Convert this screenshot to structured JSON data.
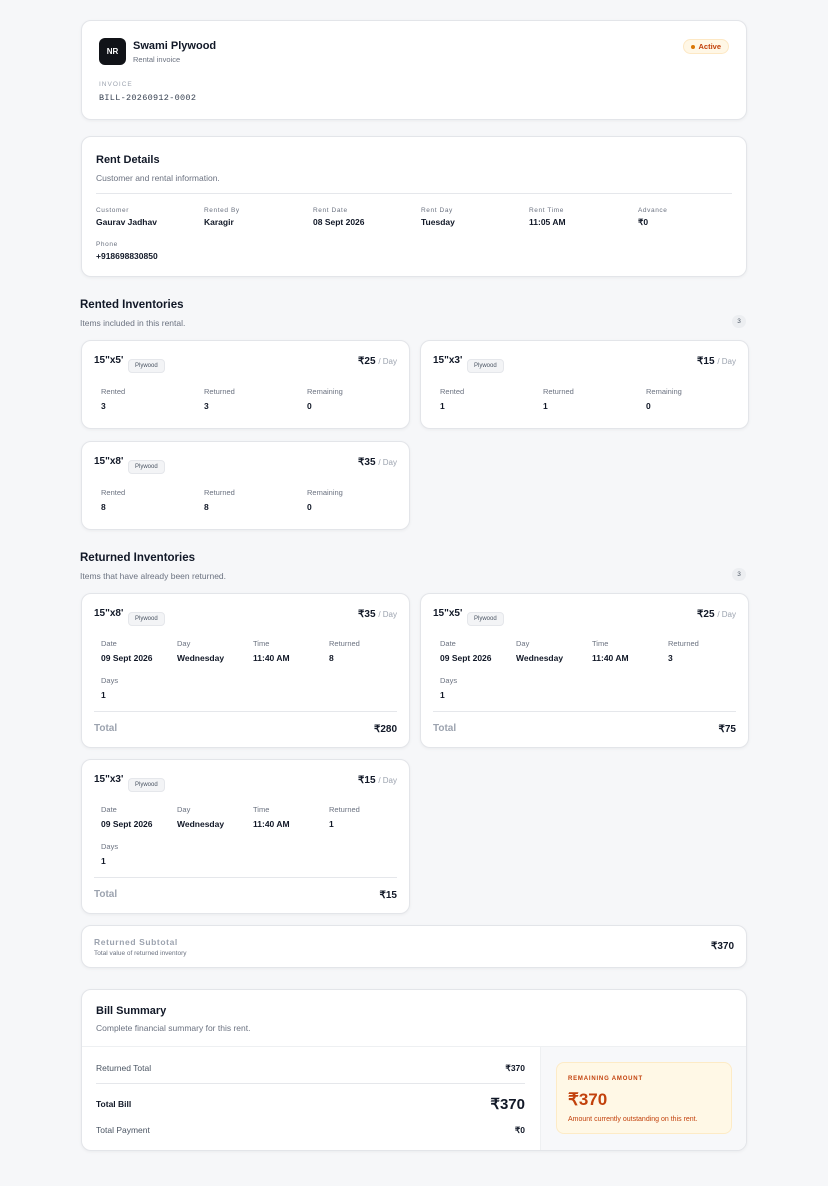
{
  "header": {
    "logo_initials": "NR",
    "business_name": "Swami Plywood",
    "subtitle": "Rental invoice",
    "status": "Active",
    "invoice_label": "INVOICE",
    "invoice_number": "BILL-20260912-0002"
  },
  "rent_details": {
    "title": "Rent Details",
    "subtitle": "Customer and rental information.",
    "fields": [
      {
        "label": "Customer",
        "value": "Gaurav Jadhav"
      },
      {
        "label": "Rented By",
        "value": "Karagir"
      },
      {
        "label": "Rent Date",
        "value": "08 Sept 2026"
      },
      {
        "label": "Rent Day",
        "value": "Tuesday"
      },
      {
        "label": "Rent Time",
        "value": "11:05 AM"
      },
      {
        "label": "Advance",
        "value": "₹0"
      },
      {
        "label": "Phone",
        "value": "+918698830850"
      }
    ]
  },
  "rented": {
    "title": "Rented Inventories",
    "subtitle": "Items included in this rental.",
    "count": "3",
    "col_labels": [
      "Rented",
      "Returned",
      "Remaining"
    ],
    "per_label": "/ Day",
    "items": [
      {
        "name": "15\"x5'",
        "tag": "Plywood",
        "rate": "₹25",
        "values": [
          "3",
          "3",
          "0"
        ]
      },
      {
        "name": "15\"x3'",
        "tag": "Plywood",
        "rate": "₹15",
        "values": [
          "1",
          "1",
          "0"
        ]
      },
      {
        "name": "15\"x8'",
        "tag": "Plywood",
        "rate": "₹35",
        "values": [
          "8",
          "8",
          "0"
        ]
      }
    ]
  },
  "returned": {
    "title": "Returned Inventories",
    "subtitle": "Items that have already been returned.",
    "count": "3",
    "col_labels": [
      "Date",
      "Day",
      "Time",
      "Returned",
      "Days"
    ],
    "per_label": "/ Day",
    "total_label": "Total",
    "items": [
      {
        "name": "15\"x8'",
        "tag": "Plywood",
        "rate": "₹35",
        "date": "09 Sept 2026",
        "day": "Wednesday",
        "time": "11:40 AM",
        "returned": "8",
        "days": "1",
        "total": "₹280"
      },
      {
        "name": "15\"x5'",
        "tag": "Plywood",
        "rate": "₹25",
        "date": "09 Sept 2026",
        "day": "Wednesday",
        "time": "11:40 AM",
        "returned": "3",
        "days": "1",
        "total": "₹75"
      },
      {
        "name": "15\"x3'",
        "tag": "Plywood",
        "rate": "₹15",
        "date": "09 Sept 2026",
        "day": "Wednesday",
        "time": "11:40 AM",
        "returned": "1",
        "days": "1",
        "total": "₹15"
      }
    ]
  },
  "subtotal": {
    "label": "Returned Subtotal",
    "sub": "Total value of returned inventory",
    "value": "₹370"
  },
  "summary": {
    "title": "Bill Summary",
    "subtitle": "Complete financial summary for this rent.",
    "returned_total_label": "Returned Total",
    "returned_total_value": "₹370",
    "total_bill_label": "Total Bill",
    "total_bill_value": "₹370",
    "total_payment_label": "Total Payment",
    "total_payment_value": "₹0",
    "remaining_label": "REMAINING AMOUNT",
    "remaining_value": "₹370",
    "remaining_note": "Amount currently outstanding on this rent."
  },
  "colors": {
    "accent_orange": "#c2410c",
    "active_badge_bg": "#fff7e6",
    "remaining_bg": "#fff8e6"
  }
}
